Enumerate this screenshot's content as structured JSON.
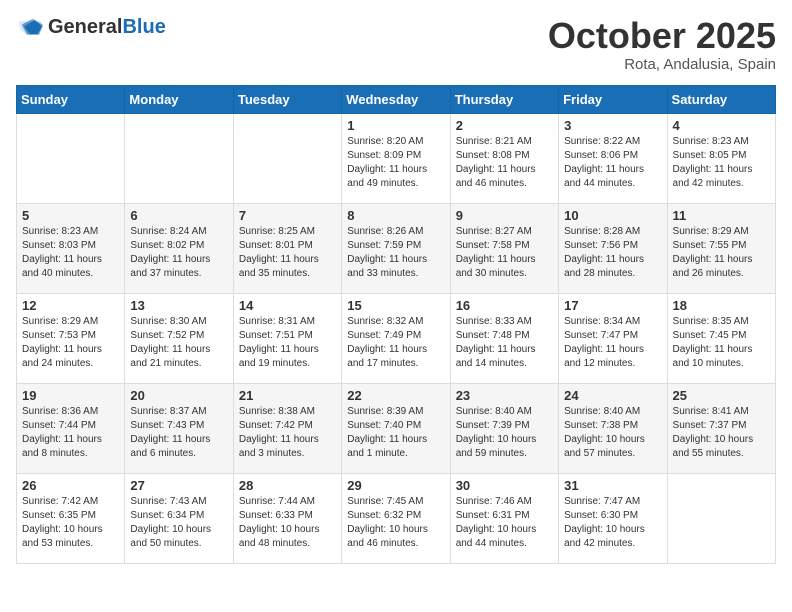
{
  "header": {
    "logo_general": "General",
    "logo_blue": "Blue",
    "month": "October 2025",
    "location": "Rota, Andalusia, Spain"
  },
  "weekdays": [
    "Sunday",
    "Monday",
    "Tuesday",
    "Wednesday",
    "Thursday",
    "Friday",
    "Saturday"
  ],
  "weeks": [
    [
      {
        "day": "",
        "sunrise": "",
        "sunset": "",
        "daylight": ""
      },
      {
        "day": "",
        "sunrise": "",
        "sunset": "",
        "daylight": ""
      },
      {
        "day": "",
        "sunrise": "",
        "sunset": "",
        "daylight": ""
      },
      {
        "day": "1",
        "sunrise": "Sunrise: 8:20 AM",
        "sunset": "Sunset: 8:09 PM",
        "daylight": "Daylight: 11 hours and 49 minutes."
      },
      {
        "day": "2",
        "sunrise": "Sunrise: 8:21 AM",
        "sunset": "Sunset: 8:08 PM",
        "daylight": "Daylight: 11 hours and 46 minutes."
      },
      {
        "day": "3",
        "sunrise": "Sunrise: 8:22 AM",
        "sunset": "Sunset: 8:06 PM",
        "daylight": "Daylight: 11 hours and 44 minutes."
      },
      {
        "day": "4",
        "sunrise": "Sunrise: 8:23 AM",
        "sunset": "Sunset: 8:05 PM",
        "daylight": "Daylight: 11 hours and 42 minutes."
      }
    ],
    [
      {
        "day": "5",
        "sunrise": "Sunrise: 8:23 AM",
        "sunset": "Sunset: 8:03 PM",
        "daylight": "Daylight: 11 hours and 40 minutes."
      },
      {
        "day": "6",
        "sunrise": "Sunrise: 8:24 AM",
        "sunset": "Sunset: 8:02 PM",
        "daylight": "Daylight: 11 hours and 37 minutes."
      },
      {
        "day": "7",
        "sunrise": "Sunrise: 8:25 AM",
        "sunset": "Sunset: 8:01 PM",
        "daylight": "Daylight: 11 hours and 35 minutes."
      },
      {
        "day": "8",
        "sunrise": "Sunrise: 8:26 AM",
        "sunset": "Sunset: 7:59 PM",
        "daylight": "Daylight: 11 hours and 33 minutes."
      },
      {
        "day": "9",
        "sunrise": "Sunrise: 8:27 AM",
        "sunset": "Sunset: 7:58 PM",
        "daylight": "Daylight: 11 hours and 30 minutes."
      },
      {
        "day": "10",
        "sunrise": "Sunrise: 8:28 AM",
        "sunset": "Sunset: 7:56 PM",
        "daylight": "Daylight: 11 hours and 28 minutes."
      },
      {
        "day": "11",
        "sunrise": "Sunrise: 8:29 AM",
        "sunset": "Sunset: 7:55 PM",
        "daylight": "Daylight: 11 hours and 26 minutes."
      }
    ],
    [
      {
        "day": "12",
        "sunrise": "Sunrise: 8:29 AM",
        "sunset": "Sunset: 7:53 PM",
        "daylight": "Daylight: 11 hours and 24 minutes."
      },
      {
        "day": "13",
        "sunrise": "Sunrise: 8:30 AM",
        "sunset": "Sunset: 7:52 PM",
        "daylight": "Daylight: 11 hours and 21 minutes."
      },
      {
        "day": "14",
        "sunrise": "Sunrise: 8:31 AM",
        "sunset": "Sunset: 7:51 PM",
        "daylight": "Daylight: 11 hours and 19 minutes."
      },
      {
        "day": "15",
        "sunrise": "Sunrise: 8:32 AM",
        "sunset": "Sunset: 7:49 PM",
        "daylight": "Daylight: 11 hours and 17 minutes."
      },
      {
        "day": "16",
        "sunrise": "Sunrise: 8:33 AM",
        "sunset": "Sunset: 7:48 PM",
        "daylight": "Daylight: 11 hours and 14 minutes."
      },
      {
        "day": "17",
        "sunrise": "Sunrise: 8:34 AM",
        "sunset": "Sunset: 7:47 PM",
        "daylight": "Daylight: 11 hours and 12 minutes."
      },
      {
        "day": "18",
        "sunrise": "Sunrise: 8:35 AM",
        "sunset": "Sunset: 7:45 PM",
        "daylight": "Daylight: 11 hours and 10 minutes."
      }
    ],
    [
      {
        "day": "19",
        "sunrise": "Sunrise: 8:36 AM",
        "sunset": "Sunset: 7:44 PM",
        "daylight": "Daylight: 11 hours and 8 minutes."
      },
      {
        "day": "20",
        "sunrise": "Sunrise: 8:37 AM",
        "sunset": "Sunset: 7:43 PM",
        "daylight": "Daylight: 11 hours and 6 minutes."
      },
      {
        "day": "21",
        "sunrise": "Sunrise: 8:38 AM",
        "sunset": "Sunset: 7:42 PM",
        "daylight": "Daylight: 11 hours and 3 minutes."
      },
      {
        "day": "22",
        "sunrise": "Sunrise: 8:39 AM",
        "sunset": "Sunset: 7:40 PM",
        "daylight": "Daylight: 11 hours and 1 minute."
      },
      {
        "day": "23",
        "sunrise": "Sunrise: 8:40 AM",
        "sunset": "Sunset: 7:39 PM",
        "daylight": "Daylight: 10 hours and 59 minutes."
      },
      {
        "day": "24",
        "sunrise": "Sunrise: 8:40 AM",
        "sunset": "Sunset: 7:38 PM",
        "daylight": "Daylight: 10 hours and 57 minutes."
      },
      {
        "day": "25",
        "sunrise": "Sunrise: 8:41 AM",
        "sunset": "Sunset: 7:37 PM",
        "daylight": "Daylight: 10 hours and 55 minutes."
      }
    ],
    [
      {
        "day": "26",
        "sunrise": "Sunrise: 7:42 AM",
        "sunset": "Sunset: 6:35 PM",
        "daylight": "Daylight: 10 hours and 53 minutes."
      },
      {
        "day": "27",
        "sunrise": "Sunrise: 7:43 AM",
        "sunset": "Sunset: 6:34 PM",
        "daylight": "Daylight: 10 hours and 50 minutes."
      },
      {
        "day": "28",
        "sunrise": "Sunrise: 7:44 AM",
        "sunset": "Sunset: 6:33 PM",
        "daylight": "Daylight: 10 hours and 48 minutes."
      },
      {
        "day": "29",
        "sunrise": "Sunrise: 7:45 AM",
        "sunset": "Sunset: 6:32 PM",
        "daylight": "Daylight: 10 hours and 46 minutes."
      },
      {
        "day": "30",
        "sunrise": "Sunrise: 7:46 AM",
        "sunset": "Sunset: 6:31 PM",
        "daylight": "Daylight: 10 hours and 44 minutes."
      },
      {
        "day": "31",
        "sunrise": "Sunrise: 7:47 AM",
        "sunset": "Sunset: 6:30 PM",
        "daylight": "Daylight: 10 hours and 42 minutes."
      },
      {
        "day": "",
        "sunrise": "",
        "sunset": "",
        "daylight": ""
      }
    ]
  ]
}
